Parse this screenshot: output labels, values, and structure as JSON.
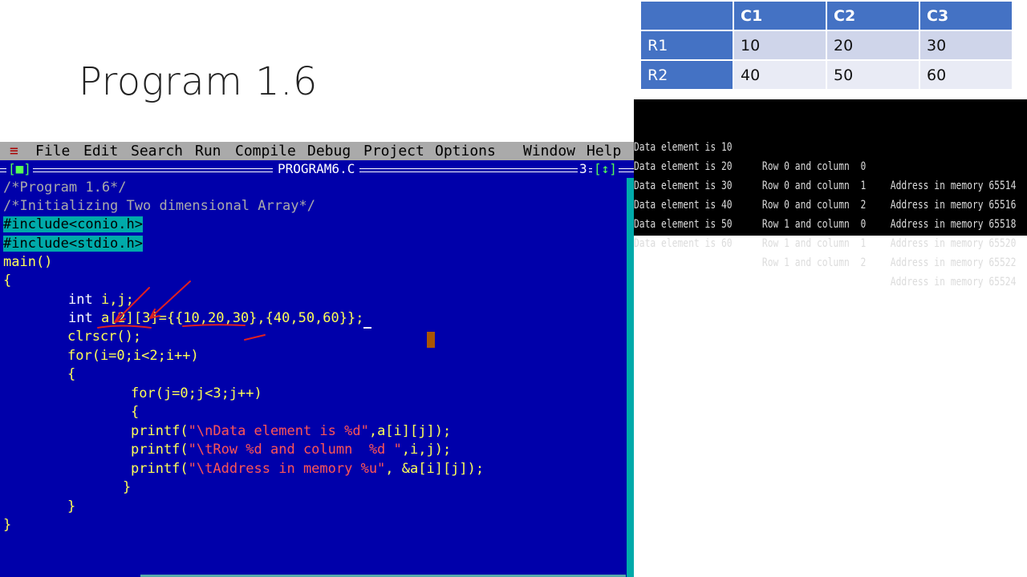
{
  "slide": {
    "title": "Program 1.6"
  },
  "table": {
    "header": [
      "",
      "C1",
      "C2",
      "C3"
    ],
    "rows": [
      {
        "label": "R1",
        "values": [
          "10",
          "20",
          "30"
        ]
      },
      {
        "label": "R2",
        "values": [
          "40",
          "50",
          "60"
        ]
      }
    ]
  },
  "output": {
    "lines": [
      {
        "data": "Data element is 10",
        "pos": "Row 0 and column  0",
        "addr": "Address in memory 65514"
      },
      {
        "data": "Data element is 20",
        "pos": "Row 0 and column  1",
        "addr": "Address in memory 65516"
      },
      {
        "data": "Data element is 30",
        "pos": "Row 0 and column  2",
        "addr": "Address in memory 65518"
      },
      {
        "data": "Data element is 40",
        "pos": "Row 1 and column  0",
        "addr": "Address in memory 65520"
      },
      {
        "data": "Data element is 50",
        "pos": "Row 1 and column  1",
        "addr": "Address in memory 65522"
      },
      {
        "data": "Data element is 60",
        "pos": "Row 1 and column  2",
        "addr": "Address in memory 65524"
      }
    ]
  },
  "ide": {
    "menu": {
      "system": "≡",
      "file": "File",
      "edit": "Edit",
      "search": "Search",
      "run": "Run",
      "compile": "Compile",
      "debug": "Debug",
      "project": "Project",
      "options": "Options",
      "window": "Window",
      "help": "Help"
    },
    "window": {
      "close_box": "[■]",
      "filename": "PROGRAM6.C",
      "number": "3",
      "zoom_box": "[↕]"
    },
    "code": {
      "l1": "/*Program 1.6*/",
      "l2": "/*Initializing Two dimensional Array*/",
      "l3": "#include<conio.h>",
      "l4": "#include<stdio.h>",
      "l5": "main()",
      "l6": "{",
      "l7_kw": "int",
      "l7_rest": " i,j;",
      "l8_kw": "int",
      "l8_rest": " a[2][3]={{10,20,30},{40,50,60}};",
      "l9": "clrscr();",
      "l10": "for(i=0;i<2;i++)",
      "l11": "{",
      "l12": "for(j=0;j<3;j++)",
      "l13": "{",
      "l14_fn": "printf(",
      "l14_str": "\"\\nData element is %d\"",
      "l14_rest": ",a[i][j]);",
      "l15_fn": "printf(",
      "l15_str": "\"\\tRow %d and column  %d \"",
      "l15_rest": ",i,j);",
      "l16_fn": "printf(",
      "l16_str": "\"\\tAddress in memory %u\"",
      "l16_rest": ", &a[i][j]);",
      "l17": "}",
      "l18": "}",
      "l19": "}"
    },
    "colors": {
      "background": "#0000aa",
      "menubar": "#aaaaaa",
      "accent": "#aa0000",
      "annotation": "#e02020"
    }
  }
}
